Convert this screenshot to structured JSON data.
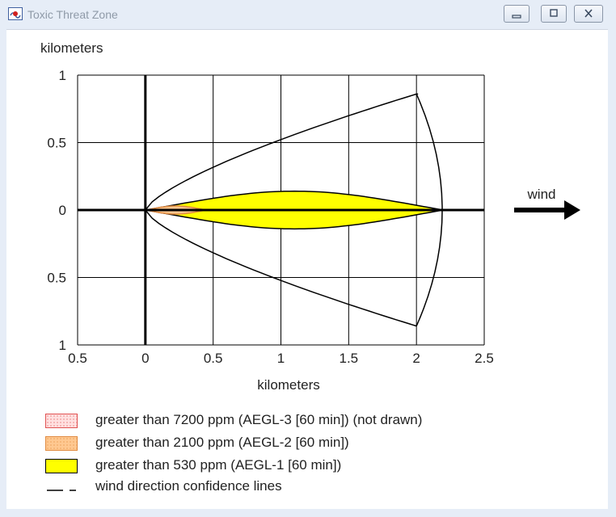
{
  "window": {
    "title": "Toxic Threat Zone"
  },
  "legend": {
    "items": [
      {
        "label": "greater than 7200 ppm (AEGL-3 [60 min]) (not drawn)",
        "fill": "#ffe0e0",
        "border": "#e05050"
      },
      {
        "label": "greater than 2100 ppm (AEGL-2 [60 min])",
        "fill": "#ffc890",
        "border": "#e08a40"
      },
      {
        "label": "greater than 530 ppm (AEGL-1 [60 min])",
        "fill": "#ffff00",
        "border": "#000000"
      },
      {
        "label": "wind direction confidence lines"
      }
    ]
  },
  "chart_data": {
    "type": "area",
    "ylabel": "kilometers",
    "xlabel": "kilometers",
    "xlim": [
      -0.5,
      2.5
    ],
    "ylim": [
      -1,
      1
    ],
    "xticks": [
      "0.5",
      "0",
      "0.5",
      "1",
      "1.5",
      "2",
      "2.5"
    ],
    "yticks": [
      "1",
      "0.5",
      "0",
      "0.5",
      "1"
    ],
    "wind_label": "wind",
    "grid": true,
    "zones": {
      "aegl1_length_km": 2.2,
      "aegl1_max_halfwidth_km": 0.14,
      "aegl2_length_km": 0.45,
      "aegl2_max_halfwidth_km": 0.03
    },
    "confidence_lines": {
      "end_x_km": 2.0,
      "end_halfwidth_km": 0.86,
      "arc_tip_km": 2.2
    }
  }
}
